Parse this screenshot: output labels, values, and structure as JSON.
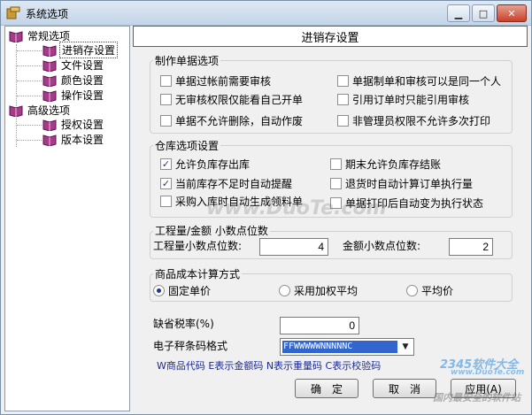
{
  "window": {
    "title": "系统选项"
  },
  "tree": {
    "groups": [
      {
        "label": "常规选项",
        "children": [
          "进销存设置",
          "文件设置",
          "颜色设置",
          "操作设置"
        ]
      },
      {
        "label": "高级选项",
        "children": [
          "授权设置",
          "版本设置"
        ]
      }
    ],
    "selected": "进销存设置"
  },
  "header": {
    "title": "进销存设置"
  },
  "doc_options": {
    "title": "制作单据选项",
    "items": [
      {
        "label": "单据过帐前需要审核",
        "checked": false
      },
      {
        "label": "单据制单和审核可以是同一个人",
        "checked": false
      },
      {
        "label": "无审核权限仅能看自己开单",
        "checked": false
      },
      {
        "label": "引用订单时只能引用审核",
        "checked": false
      },
      {
        "label": "单据不允许删除，自动作废",
        "checked": false
      },
      {
        "label": "非管理员权限不允许多次打印",
        "checked": false
      }
    ]
  },
  "warehouse": {
    "title": "仓库选项设置",
    "items": [
      {
        "label": "允许负库存出库",
        "checked": true
      },
      {
        "label": "期末允许负库存结账",
        "checked": false
      },
      {
        "label": "当前库存不足时自动提醒",
        "checked": true
      },
      {
        "label": "退货时自动计算订单执行量",
        "checked": false
      },
      {
        "label": "采购入库时自动生成领料单",
        "checked": false
      },
      {
        "label": "单据打印后自动变为执行状态",
        "checked": false
      }
    ]
  },
  "decimals": {
    "title": "工程量/金额  小数点位数",
    "qty_label": "工程量小数点位数:",
    "qty_value": "4",
    "amount_label": "金额小数点位数:",
    "amount_value": "2"
  },
  "cost": {
    "title": "商品成本计算方式",
    "options": [
      {
        "label": "固定单价",
        "selected": true
      },
      {
        "label": "采用加权平均",
        "selected": false
      },
      {
        "label": "平均价",
        "selected": false
      }
    ]
  },
  "tax": {
    "label": "缺省税率(%)",
    "value": "0"
  },
  "barcode": {
    "label": "电子秤条码格式",
    "value": "FFWWWWWNNNNNC",
    "legend": "W商品代码 E表示金额码 N表示重量码 C表示校验码"
  },
  "buttons": {
    "ok": "确　定",
    "cancel": "取　消",
    "apply": "应用(A)"
  },
  "watermarks": {
    "center": "www.DuoTe.com",
    "brand": "2345软件大全",
    "url": "www.DuoTe.com",
    "site": "国内最安全的软件站"
  },
  "colors": {
    "accent": "#1a3a8a",
    "titlebar": "#c4d5e8",
    "selection": "#3366cc"
  }
}
